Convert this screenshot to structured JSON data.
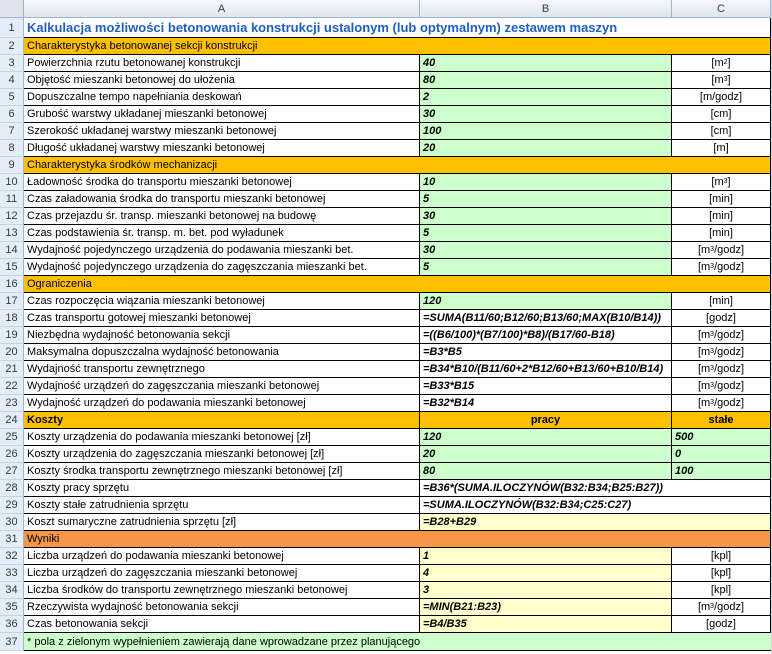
{
  "columns": [
    "A",
    "B",
    "C"
  ],
  "rows": [
    {
      "n": "1",
      "type": "title",
      "a": "Kalkulacja możliwości betonowania konstrukcji ustalonym (lub optymalnym) zestawem maszyn"
    },
    {
      "n": "2",
      "type": "section",
      "a": "Charakterystyka betonowanej sekcji konstrukcji"
    },
    {
      "n": "3",
      "a": "Powierzchnia rzutu betonowanej konstrukcji",
      "b": "40",
      "c": "[m",
      "sup": "2",
      "end": "]",
      "bfill": "green"
    },
    {
      "n": "4",
      "a": "Objętość mieszanki betonowej do ułożenia",
      "b": "80",
      "c": "[m",
      "sup": "3",
      "end": "]",
      "bfill": "green"
    },
    {
      "n": "5",
      "a": "Dopuszczalne tempo napełniania deskowań",
      "b": "2",
      "c": "[m/godz]",
      "bfill": "green"
    },
    {
      "n": "6",
      "a": "Grubość warstwy układanej mieszanki betonowej",
      "b": "30",
      "c": "[cm]",
      "bfill": "green"
    },
    {
      "n": "7",
      "a": "Szerokość układanej warstwy mieszanki betonowej",
      "b": "100",
      "c": "[cm]",
      "bfill": "green"
    },
    {
      "n": "8",
      "a": "Długość układanej warstwy mieszanki betonowej",
      "b": "20",
      "c": "[m]",
      "bfill": "green"
    },
    {
      "n": "9",
      "type": "section",
      "a": "Charakterystyka środków mechanizacji"
    },
    {
      "n": "10",
      "a": "Ładowność środka do transportu mieszanki betonowej",
      "b": "10",
      "c": "[m",
      "sup": "3",
      "end": "]",
      "bfill": "green"
    },
    {
      "n": "11",
      "a": "Czas załadowania środka do transportu mieszanki betonowej",
      "b": "5",
      "c": "[min]",
      "bfill": "green"
    },
    {
      "n": "12",
      "a": "Czas przejazdu śr. transp. mieszanki betonowej na budowę",
      "b": "30",
      "c": "[min]",
      "bfill": "green"
    },
    {
      "n": "13",
      "a": "Czas podstawienia śr. transp. m. bet. pod wyładunek",
      "b": "5",
      "c": "[min]",
      "bfill": "green"
    },
    {
      "n": "14",
      "a": "Wydajność pojedynczego urządzenia do podawania mieszanki bet.",
      "b": "30",
      "c": "[m",
      "sup": "3",
      "end": "/godz]",
      "bfill": "green"
    },
    {
      "n": "15",
      "a": "Wydajność pojedynczego urządzenia do zagęszczania mieszanki bet.",
      "b": "5",
      "c": "[m",
      "sup": "3",
      "end": "/godz]",
      "bfill": "green"
    },
    {
      "n": "16",
      "type": "section",
      "a": "Ograniczenia"
    },
    {
      "n": "17",
      "a": "Czas rozpoczęcia wiązania mieszanki betonowej",
      "b": "120",
      "c": "[min]",
      "bfill": "green"
    },
    {
      "n": "18",
      "a": "Czas transportu gotowej mieszanki betonowej",
      "b": "=SUMA(B11/60;B12/60;B13/60;MAX(B10/B14))",
      "c": "[godz]",
      "bfill": "white"
    },
    {
      "n": "19",
      "a": "Niezbędna wydajność betonowania sekcji",
      "b": "=((B6/100)*(B7/100)*B8)/(B17/60-B18)",
      "c": "[m",
      "sup": "3",
      "end": "/godz]",
      "bfill": "white"
    },
    {
      "n": "20",
      "a": "Maksymalna dopuszczalna wydajność betonowania",
      "b": "=B3*B5",
      "c": "[m",
      "sup": "3",
      "end": "/godz]",
      "bfill": "white"
    },
    {
      "n": "21",
      "a": "Wydajność transportu zewnętrznego",
      "b": "=B34*B10/(B11/60+2*B12/60+B13/60+B10/B14)",
      "c": "[m",
      "sup": "3",
      "end": "/godz]",
      "bfill": "white"
    },
    {
      "n": "22",
      "a": "Wydajność urządzeń do zagęszczania mieszanki betonowej",
      "b": "=B33*B15",
      "c": "[m",
      "sup": "3",
      "end": "/godz]",
      "bfill": "white"
    },
    {
      "n": "23",
      "a": "Wydajność urządzeń do podawania mieszanki betonowej",
      "b": "=B32*B14",
      "c": "[m",
      "sup": "3",
      "end": "/godz]",
      "bfill": "white"
    },
    {
      "n": "24",
      "type": "costhead",
      "a": "Koszty",
      "b": "pracy",
      "c": "stałe"
    },
    {
      "n": "25",
      "type": "cost",
      "a": "Koszty urządzenia do podawania mieszanki betonowej [zł]",
      "b": "120",
      "c": "500"
    },
    {
      "n": "26",
      "type": "cost",
      "a": "Koszty urządzenia do zagęszczania mieszanki betonowej [zł]",
      "b": "20",
      "c": "0"
    },
    {
      "n": "27",
      "type": "cost",
      "a": "Koszty środka transportu zewnętrznego  mieszanki betonowej [zł]",
      "b": "80",
      "c": "100"
    },
    {
      "n": "28",
      "type": "formula",
      "a": "Koszty pracy sprzętu",
      "b": "=B36*(SUMA.ILOCZYNÓW(B32:B34;B25:B27))"
    },
    {
      "n": "29",
      "type": "formula",
      "a": "Koszty stałe zatrudnienia sprzętu",
      "b": "=SUMA.ILOCZYNÓW(B32:B34;C25:C27)"
    },
    {
      "n": "30",
      "type": "formulay",
      "a": "Koszt sumaryczne zatrudnienia  sprzętu [zł]",
      "b": "=B28+B29"
    },
    {
      "n": "31",
      "type": "results",
      "a": "Wyniki"
    },
    {
      "n": "32",
      "a": "Liczba urządzeń do podawania mieszanki betonowej",
      "b": "1",
      "c": "[kpl]",
      "bfill": "yellow"
    },
    {
      "n": "33",
      "a": "Liczba urządzeń do zagęszczania mieszanki betonowej",
      "b": "4",
      "c": "[kpl]",
      "bfill": "yellow"
    },
    {
      "n": "34",
      "a": "Liczba środków do transportu zewnętrznego mieszanki betonowej",
      "b": "3",
      "c": "[kpl]",
      "bfill": "yellow"
    },
    {
      "n": "35",
      "a": "Rzeczywista wydajność betonowania sekcji",
      "b": "=MIN(B21:B23)",
      "c": "[m",
      "sup": "3",
      "end": "/godz]",
      "bfill": "yellow"
    },
    {
      "n": "36",
      "a": "Czas betonowania sekcji",
      "b": "=B4/B35",
      "c": "[godz]",
      "bfill": "yellow"
    },
    {
      "n": "37",
      "type": "note",
      "a": "* pola z zielonym wypełnieniem zawierają dane  wprowadzane przez planującego"
    }
  ]
}
